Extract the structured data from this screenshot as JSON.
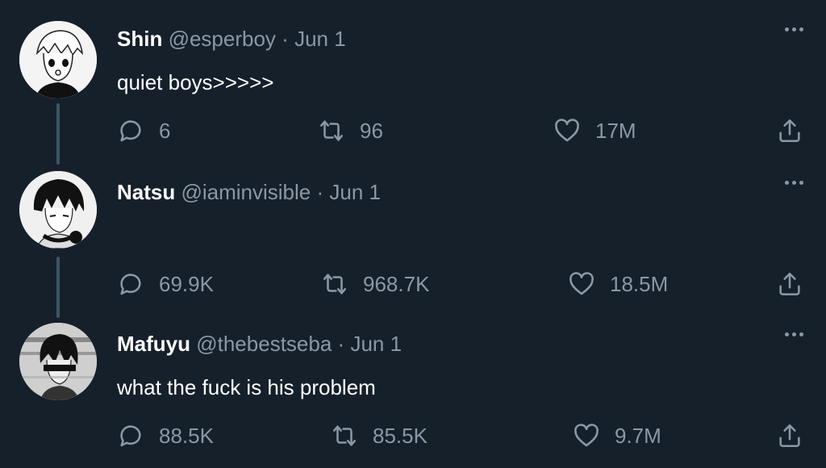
{
  "colors": {
    "background": "#15202b",
    "text_primary": "#ffffff",
    "text_secondary": "#8b98a5",
    "thread_line": "#3d5466"
  },
  "tweets": [
    {
      "name": "Shin",
      "handle": "@esperboy",
      "separator": "·",
      "date": "Jun 1",
      "text": "quiet boys>>>>>",
      "replies": "6",
      "retweets": "96",
      "likes": "17M",
      "avatar_icon": "avatar-manga-boy-icon"
    },
    {
      "name": "Natsu",
      "handle": "@iaminvisible",
      "separator": "·",
      "date": "Jun 1",
      "text": "",
      "replies": "69.9K",
      "retweets": "968.7K",
      "likes": "18.5M",
      "avatar_icon": "avatar-headphones-boy-icon"
    },
    {
      "name": "Mafuyu",
      "handle": "@thebestseba",
      "separator": "·",
      "date": "Jun 1",
      "text": "what the fuck is his problem",
      "replies": "88.5K",
      "retweets": "85.5K",
      "likes": "9.7M",
      "avatar_icon": "avatar-glitch-boy-icon"
    }
  ],
  "icons": {
    "reply": "reply-icon",
    "retweet": "retweet-icon",
    "like": "heart-icon",
    "share": "share-icon",
    "more": "more-options-icon"
  }
}
